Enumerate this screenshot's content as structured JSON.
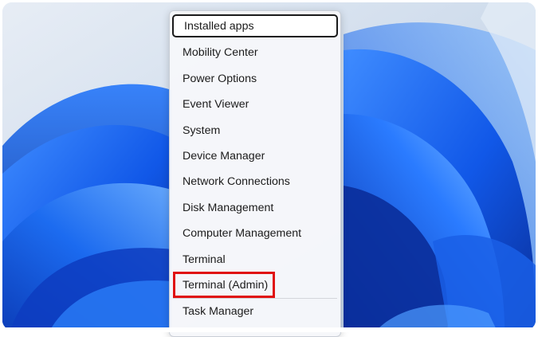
{
  "menu": {
    "items": [
      {
        "label": "Installed apps",
        "focused": true
      },
      {
        "label": "Mobility Center"
      },
      {
        "label": "Power Options"
      },
      {
        "label": "Event Viewer"
      },
      {
        "label": "System"
      },
      {
        "label": "Device Manager"
      },
      {
        "label": "Network Connections"
      },
      {
        "label": "Disk Management"
      },
      {
        "label": "Computer Management"
      },
      {
        "label": "Terminal"
      },
      {
        "label": "Terminal (Admin)",
        "highlighted": true
      },
      {
        "label": "Task Manager"
      }
    ]
  },
  "colors": {
    "wallpaper_blue": "#1c5fe0",
    "wallpaper_light": "#d8e4f2",
    "highlight_red": "#e01010"
  }
}
